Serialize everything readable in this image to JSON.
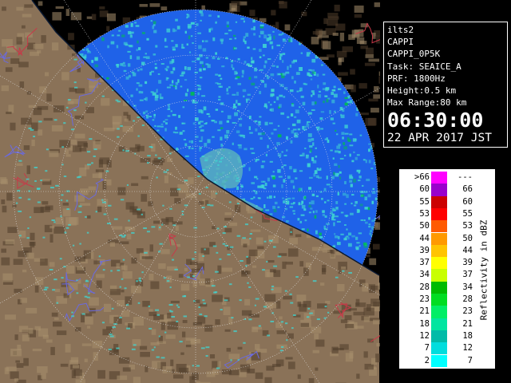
{
  "radar": {
    "site": "ilts2",
    "product": "CAPPI",
    "product_code": "CAPPI_0P5K",
    "task": "Task: SEAICE_A",
    "prf": "PRF: 1800Hz",
    "height": "Height:0.5 km",
    "max_range": "Max Range:80 km",
    "time": "06:30:00",
    "date": "22 APR 2017 JST"
  },
  "legend": {
    "unit_label": "Reflectivity in dBZ",
    "rows": [
      {
        "lo": ">66",
        "hi": "---",
        "color": "#ff00ff"
      },
      {
        "lo": "60",
        "hi": "66",
        "color": "#9900cc"
      },
      {
        "lo": "55",
        "hi": "60",
        "color": "#cc0000"
      },
      {
        "lo": "53",
        "hi": "55",
        "color": "#ff0000"
      },
      {
        "lo": "50",
        "hi": "53",
        "color": "#ff5a00"
      },
      {
        "lo": "44",
        "hi": "50",
        "color": "#ff9900"
      },
      {
        "lo": "39",
        "hi": "44",
        "color": "#ffc400"
      },
      {
        "lo": "37",
        "hi": "39",
        "color": "#ffff00"
      },
      {
        "lo": "34",
        "hi": "37",
        "color": "#c8ff00"
      },
      {
        "lo": "28",
        "hi": "34",
        "color": "#00bb00"
      },
      {
        "lo": "23",
        "hi": "28",
        "color": "#00dd22"
      },
      {
        "lo": "21",
        "hi": "23",
        "color": "#00ee66"
      },
      {
        "lo": "18",
        "hi": "21",
        "color": "#00e5a0"
      },
      {
        "lo": "12",
        "hi": "18",
        "color": "#00bba8"
      },
      {
        "lo": "7",
        "hi": "12",
        "color": "#00dddd"
      },
      {
        "lo": "2",
        "hi": "7",
        "color": "#00ffff"
      }
    ]
  },
  "colors": {
    "sea": "#1f62e8",
    "land": "#8a7258",
    "land_dark": "#4f3d2a",
    "echo": "#3fd6d2",
    "grid": "#e0e0e0",
    "river": "#6a6ae0",
    "border": "#c83848"
  }
}
